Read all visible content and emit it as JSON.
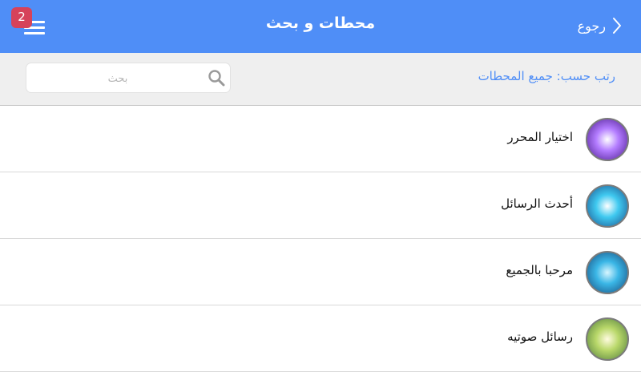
{
  "header": {
    "title": "محطات و بحث",
    "back_label": "رجوع",
    "notification_count": "2"
  },
  "filter": {
    "sort_label": "رتب حسب: جميع المحطات",
    "search_placeholder": "بحث",
    "search_value": ""
  },
  "stations": [
    {
      "label": "اختيار المحرر",
      "avatar": "purple-swirl-avatar",
      "colors": [
        "#ffffff",
        "#b37cff",
        "#4a1a8c"
      ]
    },
    {
      "label": "أحدث الرسائل",
      "avatar": "cyan-speaker-avatar",
      "colors": [
        "#ffffff",
        "#3fc9f0",
        "#1a4f8c"
      ]
    },
    {
      "label": "مرحبا بالجميع",
      "avatar": "blue-hand-avatar",
      "colors": [
        "#d8f6ff",
        "#3ab6e6",
        "#174a7c"
      ]
    },
    {
      "label": "رسائل صوتيه",
      "avatar": "green-lightbulb-avatar",
      "colors": [
        "#fffbe0",
        "#b9d86a",
        "#4d7a3a"
      ]
    }
  ],
  "theme": {
    "header_bg": "#4f8ef7",
    "accent": "#4f8ef7",
    "badge_bg": "#d6425a",
    "filter_bg": "#efefef"
  }
}
